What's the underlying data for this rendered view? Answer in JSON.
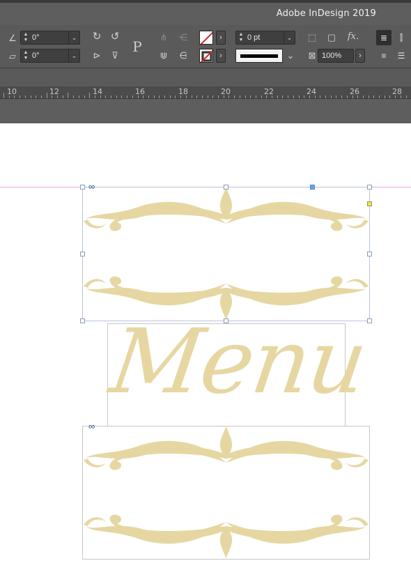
{
  "app": {
    "title": "Adobe InDesign 2019"
  },
  "control_panel": {
    "rotate_angle": "0°",
    "shear_angle": "0°",
    "stroke_weight": "0 pt",
    "opacity": "100%",
    "text_frame_label": "P",
    "fx_label": "fx."
  },
  "ruler": {
    "labels": [
      "10",
      "12",
      "14",
      "16",
      "18",
      "20",
      "22",
      "24",
      "26",
      "28"
    ]
  },
  "document": {
    "heading_text": "Menu"
  },
  "colors": {
    "ornament": "#e6d7a2",
    "guide": "#e3a9e3",
    "selection": "#6aa4e8"
  }
}
